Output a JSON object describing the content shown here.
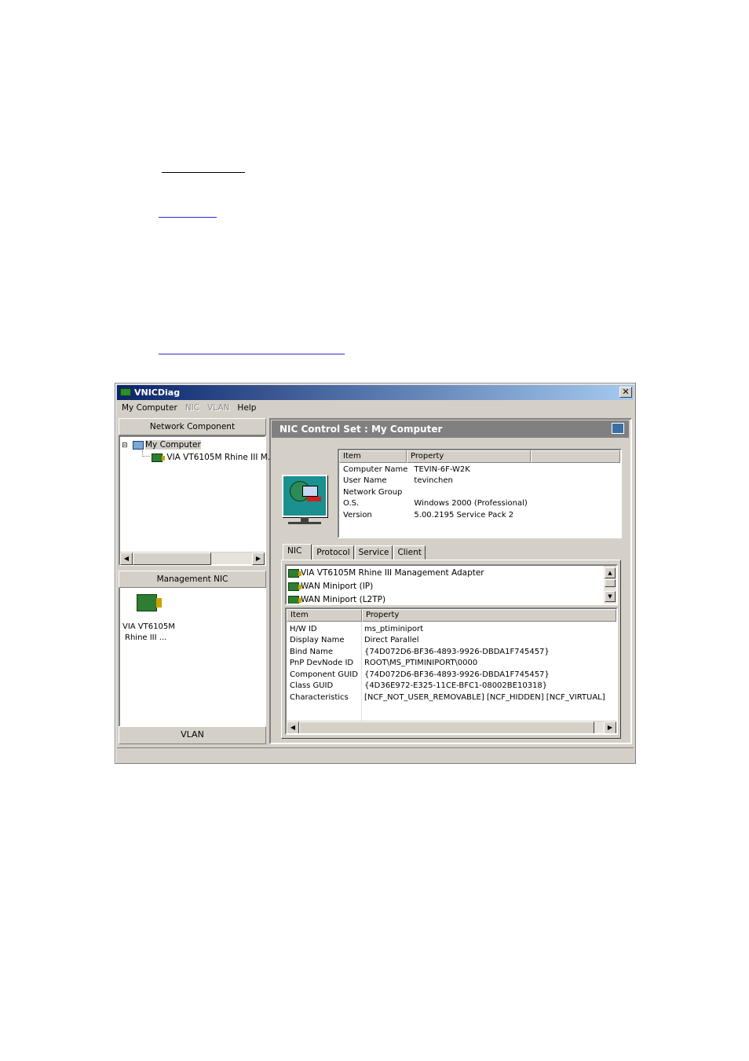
{
  "window": {
    "title": "VNICDiag",
    "close_glyph": "✕"
  },
  "menu": {
    "items": [
      {
        "label": "My Computer"
      },
      {
        "label": "NIC"
      },
      {
        "label": "VLAN"
      },
      {
        "label": "Help"
      }
    ]
  },
  "left": {
    "network_component_header": "Network Component",
    "tree": {
      "root": "My Computer",
      "child": "VIA VT6105M Rhine III M.",
      "expander": "⊟"
    },
    "management_nic_header": "Management NIC",
    "mgmt_nic_label_line1": "VIA VT6105M",
    "mgmt_nic_label_line2": "Rhine III ...",
    "vlan_button": "VLAN"
  },
  "right": {
    "header": "NIC Control Set : My Computer",
    "computer_table": {
      "columns": [
        "Item",
        "Property"
      ],
      "rows": [
        [
          "Computer Name",
          "TEVIN-6F-W2K"
        ],
        [
          "User Name",
          "tevinchen"
        ],
        [
          "Network Group",
          ""
        ],
        [
          "O.S.",
          "Windows 2000 (Professional)"
        ],
        [
          "Version",
          "5.00.2195 Service Pack 2"
        ]
      ]
    },
    "tabs": [
      {
        "label": "NIC"
      },
      {
        "label": "Protocol"
      },
      {
        "label": "Service"
      },
      {
        "label": "Client"
      }
    ],
    "nic_list": [
      "VIA VT6105M Rhine III Management Adapter",
      "WAN Miniport (IP)",
      "WAN Miniport (L2TP)"
    ],
    "property_table": {
      "columns": [
        "Item",
        "Property"
      ],
      "rows": [
        [
          "H/W ID",
          "ms_ptiminiport"
        ],
        [
          "Display Name",
          "Direct Parallel"
        ],
        [
          "Bind Name",
          "{74D072D6-BF36-4893-9926-DBDA1F745457}"
        ],
        [
          "PnP DevNode ID",
          "ROOT\\MS_PTIMINIPORT\\0000"
        ],
        [
          "Component GUID",
          "{74D072D6-BF36-4893-9926-DBDA1F745457}"
        ],
        [
          "Class GUID",
          "{4D36E972-E325-11CE-BFC1-08002BE10318}"
        ],
        [
          "Characteristics",
          "[NCF_NOT_USER_REMOVABLE] [NCF_HIDDEN] [NCF_VIRTUAL]"
        ]
      ]
    }
  },
  "scroll_glyphs": {
    "left": "◀",
    "right": "▶",
    "up": "▲",
    "down": "▼"
  }
}
